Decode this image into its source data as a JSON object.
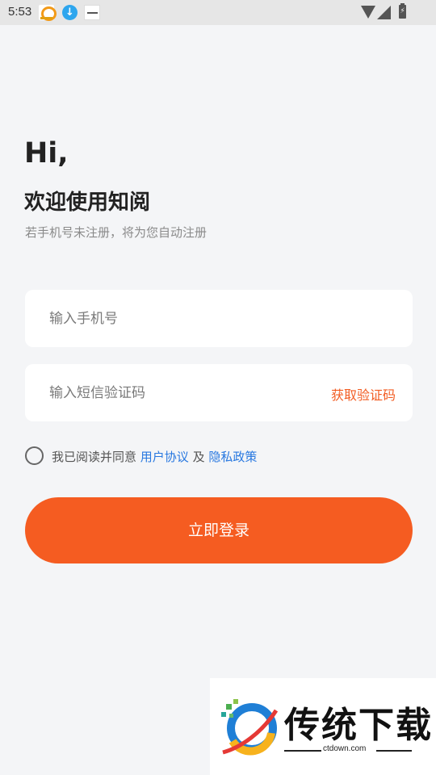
{
  "status_bar": {
    "time": "5:53",
    "icons": [
      "app-notification-icon",
      "download-icon",
      "app-notification-icon",
      "wifi-icon",
      "signal-icon",
      "battery-charging-icon"
    ]
  },
  "greeting": {
    "hi": "Hi,",
    "welcome": "欢迎使用知阅",
    "subtitle": "若手机号未注册，将为您自动注册"
  },
  "form": {
    "phone_placeholder": "输入手机号",
    "code_placeholder": "输入短信验证码",
    "get_code_label": "获取验证码"
  },
  "agreement": {
    "prefix": "我已阅读并同意 ",
    "user_agreement": "用户协议",
    "and": " 及 ",
    "privacy_policy": "隐私政策",
    "checked": false
  },
  "login_button": "立即登录",
  "watermark": {
    "title": "传统下载",
    "url": "ctdown.com"
  },
  "colors": {
    "accent": "#f55c21",
    "link": "#2878e0",
    "background": "#f4f5f7"
  }
}
